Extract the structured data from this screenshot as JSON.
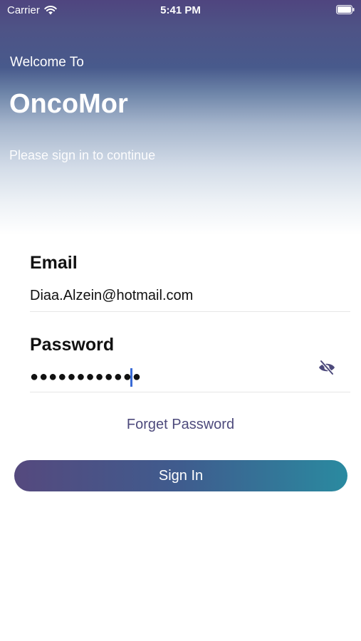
{
  "status_bar": {
    "carrier": "Carrier",
    "time": "5:41 PM"
  },
  "header": {
    "welcome": "Welcome To",
    "app_name": "OncoMor",
    "subtitle": "Please sign in to continue"
  },
  "form": {
    "email_label": "Email",
    "email_value": "Diaa.Alzein@hotmail.com",
    "password_label": "Password",
    "password_masked": "●●●●●●●●●●●●",
    "forget_password": "Forget Password",
    "sign_in": "Sign In"
  },
  "icons": {
    "wifi": "wifi-icon",
    "battery": "battery-icon",
    "password_toggle": "eye-slash-icon"
  },
  "colors": {
    "header_top": "#4f457f",
    "accent_text": "#4d4a7c",
    "button_start": "#55497e",
    "button_end": "#2a8aa0",
    "caret": "#3a6bd6"
  }
}
